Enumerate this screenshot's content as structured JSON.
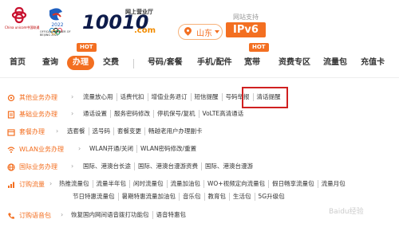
{
  "header": {
    "cu_logo_text": "China unicom中国联通",
    "olympic_text": "OFFICIAL PARTNER OF BEIJING 2022",
    "brand": "10010",
    "brand_sub": "网上营业厅",
    "brand_com": ".com",
    "region": "山东",
    "support_label": "网站支持",
    "ipv6": "IPv6"
  },
  "nav": {
    "items": [
      {
        "label": "首页"
      },
      {
        "label": "查询"
      },
      {
        "label": "办理"
      },
      {
        "label": "交费"
      },
      {
        "label": "号码/套餐"
      },
      {
        "label": "手机/配件"
      },
      {
        "label": "宽带"
      },
      {
        "label": "资费专区"
      },
      {
        "label": "流量包"
      },
      {
        "label": "充值卡"
      }
    ],
    "hot": "HOT"
  },
  "menu": [
    {
      "category": "其他业务办理",
      "items": [
        "流量放心用",
        "话费代扣",
        "增值业务退订",
        "短信提醒",
        "号码举报",
        "清话提醒"
      ]
    },
    {
      "category": "基础业务办理",
      "items": [
        "通话设置",
        "服务密码修改",
        "停机保号/复机",
        "VoLTE高清通话"
      ]
    },
    {
      "category": "套餐办理",
      "items": [
        "选套餐",
        "选号码",
        "套餐变更",
        "畅越老用户办理副卡"
      ]
    },
    {
      "category": "WLAN业务办理",
      "items": [
        "WLAN开通/关闭",
        "WLAN密码修改/重置"
      ]
    },
    {
      "category": "国际业务办理",
      "items": [
        "国际、港澳台长途",
        "国际、港澳台漫游资费",
        "国际、港澳台漫游"
      ]
    },
    {
      "category": "订购流量",
      "items": [
        "热推流量包",
        "流量半年包",
        "闲时流量包",
        "流量加油包",
        "WO+视频定向流量包",
        "假日畅享流量包",
        "流量月包"
      ]
    },
    {
      "category": "",
      "items": [
        "节日特惠流量包",
        "暑期特惠流量加油包",
        "音乐包",
        "教育包",
        "生活包",
        "5G升级包"
      ]
    },
    {
      "category": "订购语音包",
      "items": [
        "恢复国内网间语音拨打功能包",
        "语音特惠包"
      ]
    }
  ],
  "watermark": "Baidu经验"
}
